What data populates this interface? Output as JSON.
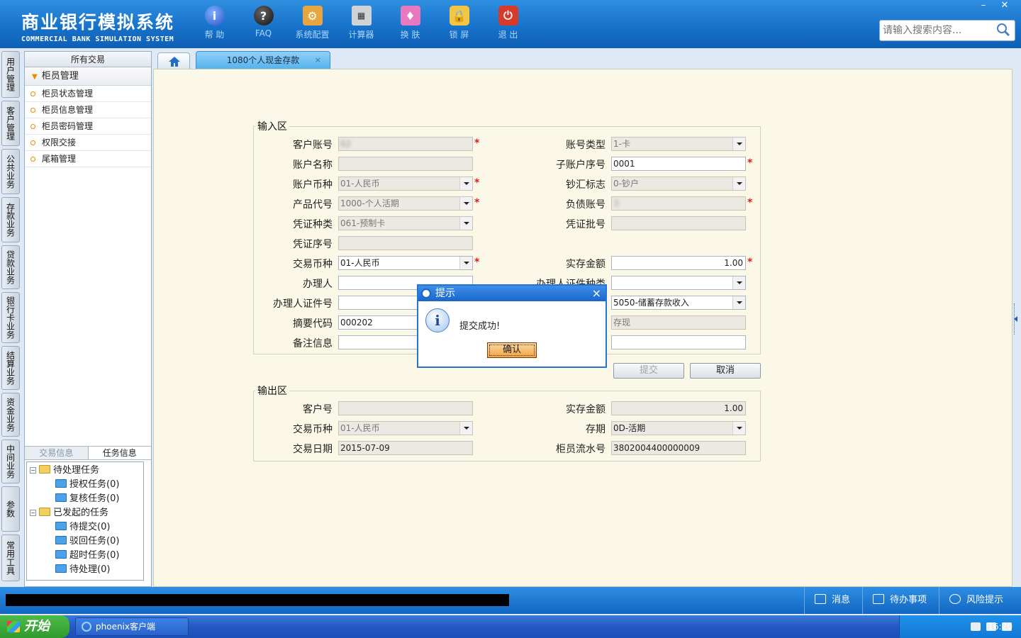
{
  "app": {
    "title_cn": "商业银行模拟系统",
    "title_en": "COMMERCIAL BANK SIMULATION SYSTEM"
  },
  "toolbar": [
    {
      "label": "帮 助",
      "icon": "help-icon",
      "glyph": "i"
    },
    {
      "label": "FAQ",
      "icon": "faq-icon",
      "glyph": "?"
    },
    {
      "label": "系统配置",
      "icon": "settings-icon",
      "glyph": "⚙"
    },
    {
      "label": "计算器",
      "icon": "calculator-icon",
      "glyph": "▦"
    },
    {
      "label": "换 肤",
      "icon": "skin-icon",
      "glyph": "♦"
    },
    {
      "label": "锁 屏",
      "icon": "lock-icon",
      "glyph": "🔒"
    },
    {
      "label": "退 出",
      "icon": "power-icon",
      "glyph": "⏻"
    }
  ],
  "search": {
    "placeholder": "请输入搜索内容..."
  },
  "vtabs": [
    "用户管理",
    "客户管理",
    "公共业务",
    "存款业务",
    "贷款业务",
    "银行卡业务",
    "结算业务",
    "资金业务",
    "中间业务",
    "参数",
    "常用工具"
  ],
  "left_panel": {
    "title": "所有交易",
    "group": "柜员管理",
    "items": [
      "柜员状态管理",
      "柜员信息管理",
      "柜员密码管理",
      "权限交接",
      "尾箱管理"
    ],
    "tabs": {
      "inactive": "交易信息",
      "active": "任务信息"
    },
    "tree": {
      "pending": "待处理任务",
      "pending_children": [
        "授权任务(0)",
        "复核任务(0)"
      ],
      "initiated": "已发起的任务",
      "initiated_children": [
        "待提交(0)",
        "驳回任务(0)",
        "超时任务(0)",
        "待处理(0)"
      ]
    }
  },
  "tabs": {
    "active": "1080个人现金存款",
    "close": "×"
  },
  "input_area": {
    "legend": "输入区",
    "labels": {
      "acct_no": "客户账号",
      "acct_name": "账户名称",
      "acct_currency": "账户币种",
      "product": "产品代号",
      "voucher_type": "凭证种类",
      "voucher_seq": "凭证序号",
      "tx_currency": "交易币种",
      "handler": "办理人",
      "handler_id_no": "办理人证件号",
      "summary_code": "摘要代码",
      "remarks": "备注信息",
      "acct_type": "账号类型",
      "sub_acct_seq": "子账户序号",
      "cash_remit": "钞汇标志",
      "liability_acct": "负债账号",
      "voucher_batch": "凭证批号",
      "amount": "实存金额",
      "handler_id_type": "办理人证件种类"
    },
    "values": {
      "acct_no": "62",
      "acct_name": "",
      "acct_currency": "01-人民币",
      "product": "1000-个人活期",
      "voucher_type": "061-预制卡",
      "voucher_seq": "",
      "tx_currency": "01-人民币",
      "handler": "",
      "handler_id_no": "",
      "summary_code": "000202",
      "remarks": "",
      "acct_type": "1-卡",
      "sub_acct_seq": "0001",
      "cash_remit": "0-钞户",
      "liability_acct": "3",
      "voucher_batch": "",
      "amount": "1.00",
      "handler_id_type": "",
      "category": "5050-储蓄存款收入",
      "summary_text": "存现"
    },
    "required_mark": "*"
  },
  "buttons": {
    "submit": "提交",
    "cancel": "取消"
  },
  "output_area": {
    "legend": "输出区",
    "labels": {
      "cust_no": "客户号",
      "tx_currency": "交易币种",
      "tx_date": "交易日期",
      "amount": "实存金额",
      "term": "存期",
      "teller_seq": "柜员流水号"
    },
    "values": {
      "cust_no": "",
      "tx_currency": "01-人民币",
      "tx_date": "2015-07-09",
      "amount": "1.00",
      "term": "0D-活期",
      "teller_seq": "3802004400000009"
    }
  },
  "dialog": {
    "title": "提示",
    "message": "提交成功!",
    "ok": "确认",
    "close": "×"
  },
  "statusbar": {
    "messages": "消息",
    "todo": "待办事项",
    "risk": "风险提示"
  },
  "taskbar": {
    "start": "开始",
    "task": "phoenix客户端",
    "clock": "16:20"
  }
}
